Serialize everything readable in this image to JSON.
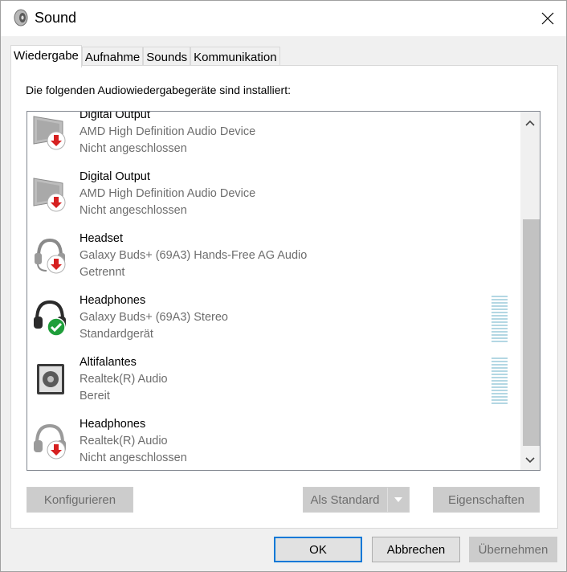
{
  "window": {
    "title": "Sound",
    "close_icon": "close-icon"
  },
  "tabs": [
    {
      "label": "Wiedergabe",
      "active": true
    },
    {
      "label": "Aufnahme",
      "active": false
    },
    {
      "label": "Sounds",
      "active": false
    },
    {
      "label": "Kommunikation",
      "active": false
    }
  ],
  "panel": {
    "description": "Die folgenden Audiowiedergabegeräte sind installiert:"
  },
  "devices": [
    {
      "name": "Digital Output",
      "device": "AMD High Definition Audio Device",
      "status": "Nicht angeschlossen",
      "icon": "monitor-icon",
      "badge": "disconnected-arrow-icon"
    },
    {
      "name": "Digital Output",
      "device": "AMD High Definition Audio Device",
      "status": "Nicht angeschlossen",
      "icon": "monitor-icon",
      "badge": "disconnected-arrow-icon"
    },
    {
      "name": "Headset",
      "device": "Galaxy Buds+ (69A3) Hands-Free AG Audio",
      "status": "Getrennt",
      "icon": "headset-icon",
      "badge": "disconnected-arrow-icon"
    },
    {
      "name": "Headphones",
      "device": "Galaxy Buds+ (69A3) Stereo",
      "status": "Standardgerät",
      "icon": "headphones-icon",
      "badge": "default-check-icon"
    },
    {
      "name": "Altifalantes",
      "device": "Realtek(R) Audio",
      "status": "Bereit",
      "icon": "speaker-icon",
      "badge": ""
    },
    {
      "name": "Headphones",
      "device": "Realtek(R) Audio",
      "status": "Nicht angeschlossen",
      "icon": "headphones-icon",
      "badge": "disconnected-arrow-icon"
    }
  ],
  "buttons": {
    "configure": "Konfigurieren",
    "set_default": "Als Standard",
    "properties": "Eigenschaften"
  },
  "dialog": {
    "ok": "OK",
    "cancel": "Abbrechen",
    "apply": "Übernehmen"
  },
  "colors": {
    "accent": "#0078d7",
    "badge_red": "#d62020",
    "badge_green": "#1f9e3a",
    "meter": "#b3d7e3"
  }
}
